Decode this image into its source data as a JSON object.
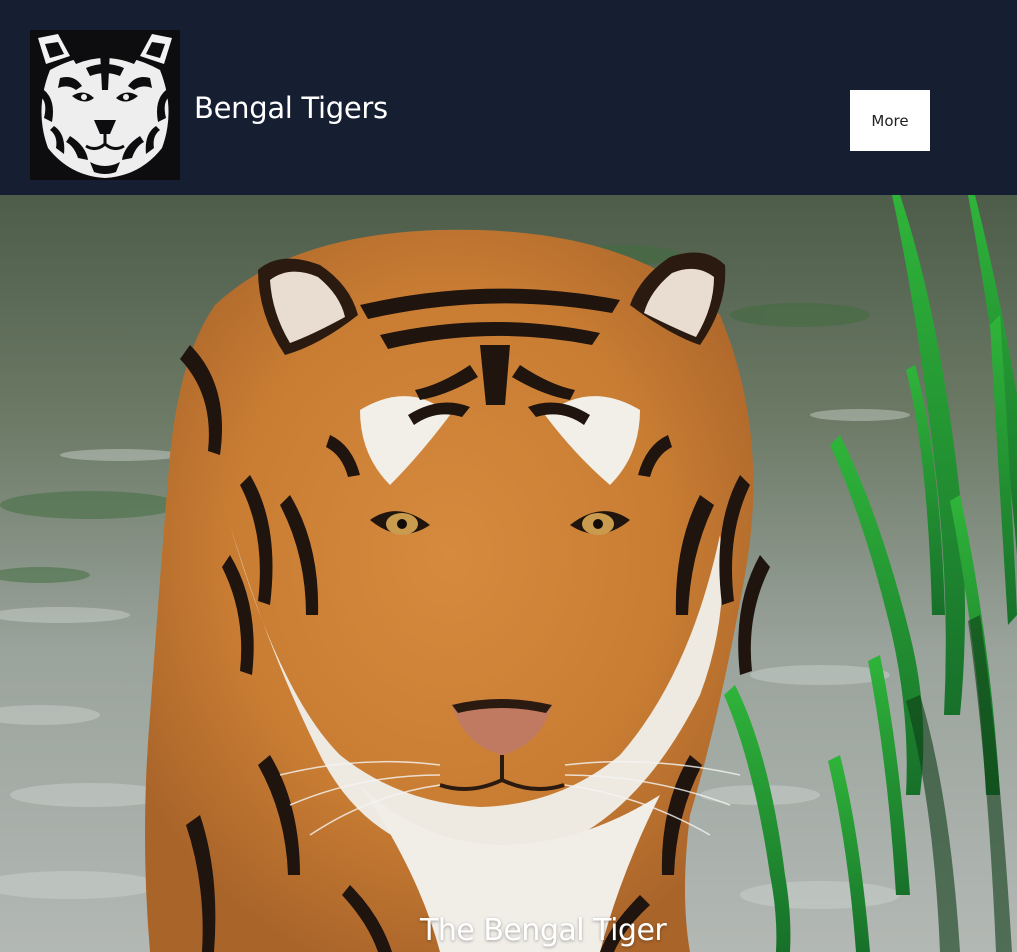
{
  "header": {
    "site_title": "Bengal Tigers",
    "more_label": "More",
    "logo_icon": "tiger-face-logo-icon",
    "background_color": "#151f31"
  },
  "hero": {
    "title": "The Bengal Tiger",
    "image_subject": "tiger-photo"
  }
}
